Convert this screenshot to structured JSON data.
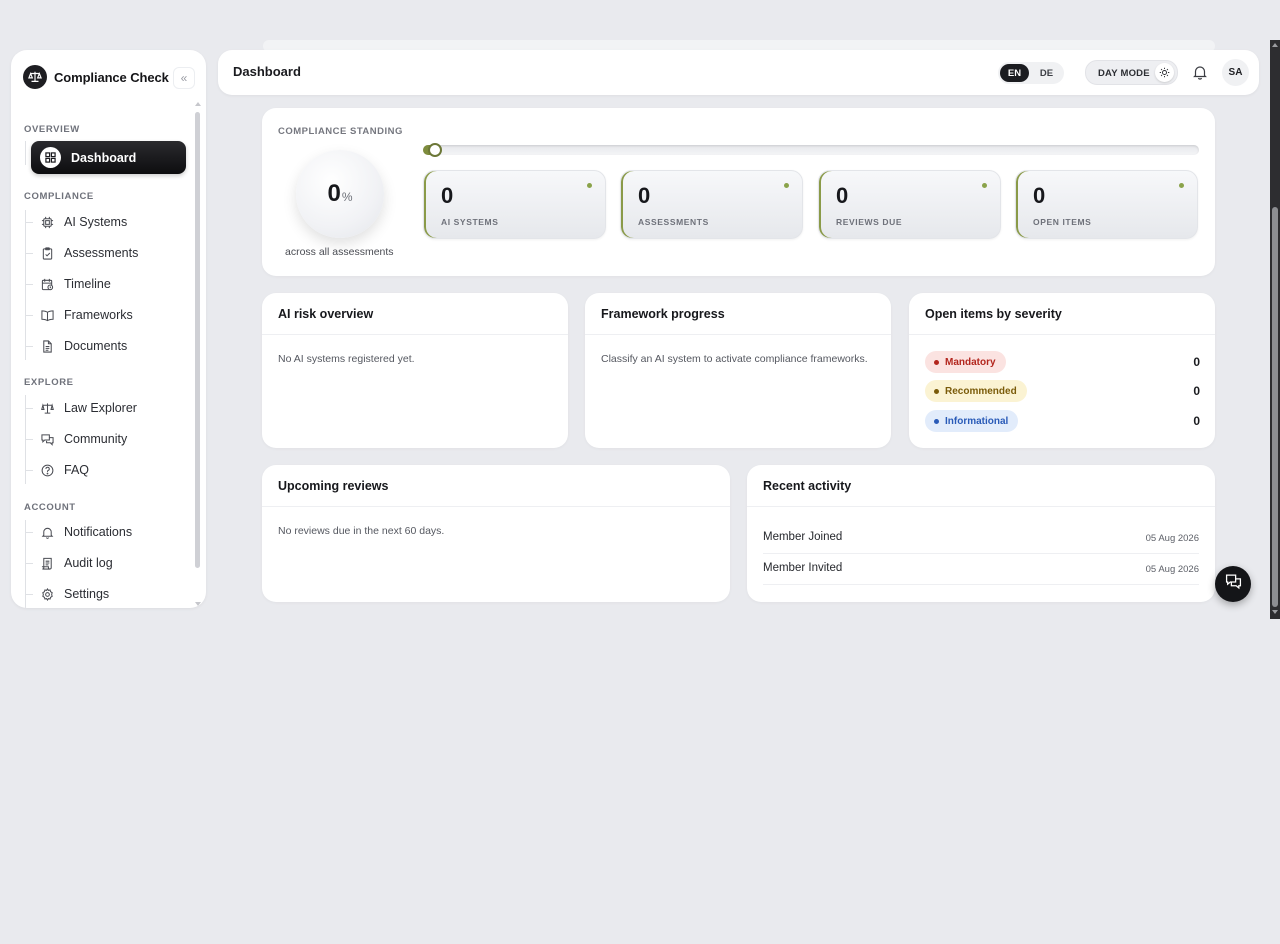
{
  "sidebar": {
    "brand": "Compliance Check",
    "collapse_label": "«",
    "sections": {
      "overview": "OVERVIEW",
      "compliance": "COMPLIANCE",
      "explore": "EXPLORE",
      "account": "ACCOUNT"
    },
    "items": {
      "dashboard": "Dashboard",
      "ai_systems": "AI Systems",
      "assessments": "Assessments",
      "timeline": "Timeline",
      "frameworks": "Frameworks",
      "documents": "Documents",
      "law_explorer": "Law Explorer",
      "community": "Community",
      "faq": "FAQ",
      "notifications": "Notifications",
      "audit_log": "Audit log",
      "settings": "Settings"
    }
  },
  "header": {
    "title": "Dashboard",
    "lang_en": "EN",
    "lang_de": "DE",
    "day_mode": "DAY MODE",
    "avatar": "SA"
  },
  "standing": {
    "label": "COMPLIANCE STANDING",
    "value": "0",
    "unit": "%",
    "progress": 0,
    "caption": "across all assessments",
    "stats": [
      {
        "value": "0",
        "label": "AI SYSTEMS"
      },
      {
        "value": "0",
        "label": "ASSESSMENTS"
      },
      {
        "value": "0",
        "label": "REVIEWS DUE"
      },
      {
        "value": "0",
        "label": "OPEN ITEMS"
      }
    ]
  },
  "risk": {
    "title": "AI risk overview",
    "empty": "No AI systems registered yet."
  },
  "frameworks": {
    "title": "Framework progress",
    "empty": "Classify an AI system to activate compliance frameworks."
  },
  "severity": {
    "title": "Open items by severity",
    "rows": [
      {
        "label": "Mandatory",
        "count": "0"
      },
      {
        "label": "Recommended",
        "count": "0"
      },
      {
        "label": "Informational",
        "count": "0"
      }
    ]
  },
  "reviews": {
    "title": "Upcoming reviews",
    "empty": "No reviews due in the next 60 days."
  },
  "activity": {
    "title": "Recent activity",
    "rows": [
      {
        "name": "Member Joined",
        "date": "05 Aug 2026"
      },
      {
        "name": "Member Invited",
        "date": "05 Aug 2026"
      }
    ]
  },
  "colors": {
    "accent": "#8a9a48",
    "mandatory_bg": "#fbe3e1",
    "mandatory_fg": "#b3261e",
    "recommended_bg": "#fbf3d3",
    "recommended_fg": "#7a5b0a",
    "informational_bg": "#e2ecfb",
    "informational_fg": "#2a5bb8"
  }
}
